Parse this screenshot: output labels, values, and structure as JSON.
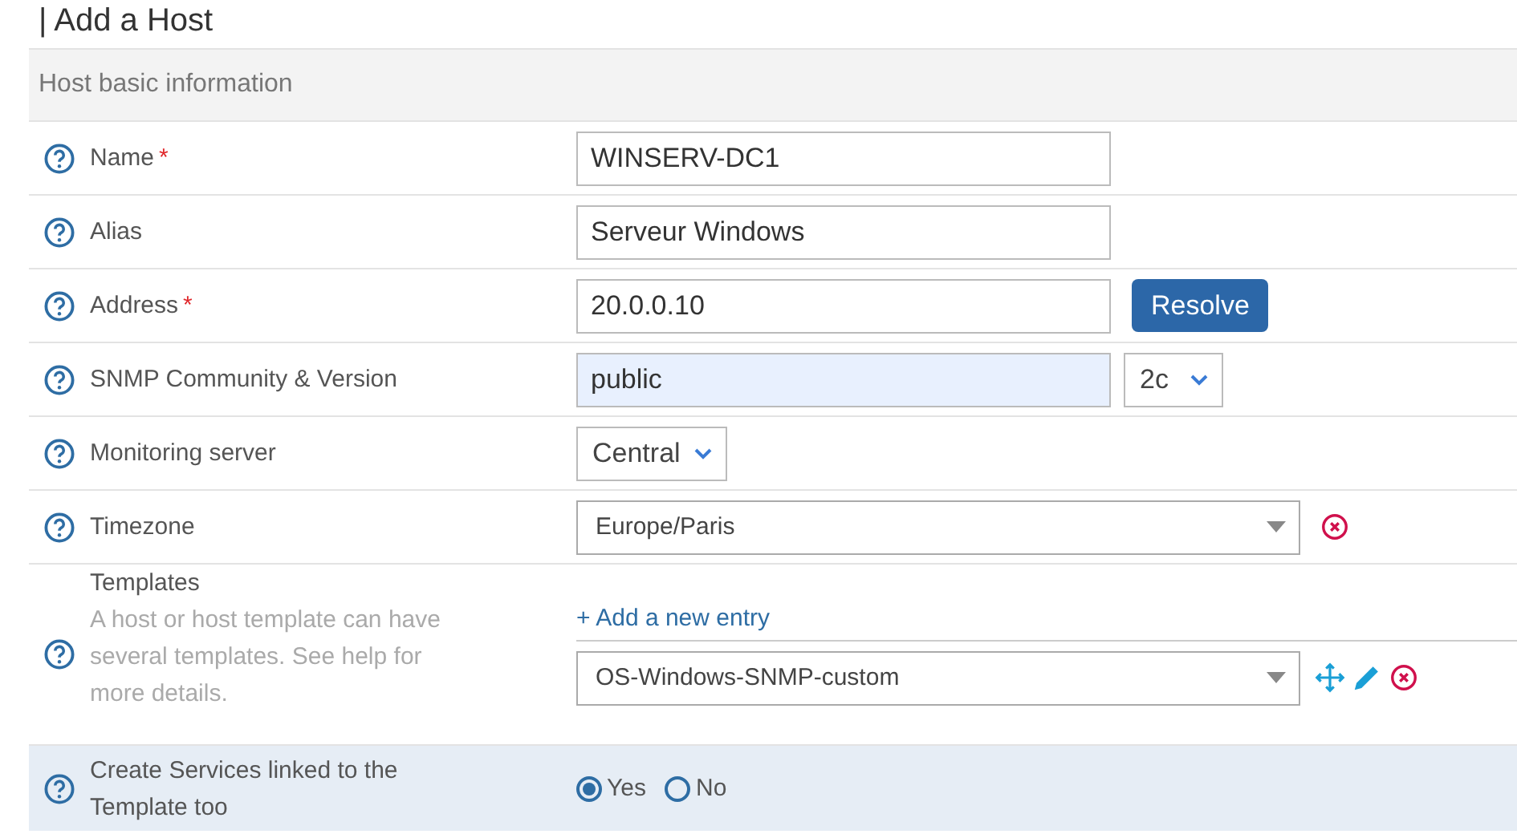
{
  "title": "| Add a Host",
  "section": "Host basic information",
  "rows": [
    {
      "kind": "text",
      "label": "Name",
      "required_mark": "*",
      "highlighted": false,
      "value": "WINSERV-DC1",
      "filled": false
    },
    {
      "kind": "text",
      "label": "Alias",
      "highlighted": false,
      "value": "Serveur Windows",
      "filled": false
    },
    {
      "kind": "text_button",
      "label": "Address",
      "required_mark": "*",
      "highlighted": false,
      "value": "20.0.0.10",
      "filled": false,
      "button": "Resolve"
    },
    {
      "kind": "text_select",
      "label": "SNMP Community & Version",
      "highlighted": false,
      "value": "public",
      "filled": true,
      "option": "2c"
    },
    {
      "kind": "select",
      "label": "Monitoring server",
      "highlighted": false,
      "option": "Central"
    },
    {
      "kind": "combo",
      "label": "Timezone",
      "highlighted": false,
      "option": "Europe/Paris"
    },
    {
      "kind": "templates",
      "label": "Templates",
      "highlighted": false,
      "hint": "A host or host template can have several templates. See help for more details.",
      "add": "+ Add a new entry",
      "option": "OS-Windows-SNMP-custom"
    },
    {
      "kind": "radio",
      "label": "Create Services linked to the Template too",
      "highlighted": true,
      "options": [
        {
          "label": "Yes",
          "selected": true
        },
        {
          "label": "No",
          "selected": false
        }
      ]
    }
  ]
}
